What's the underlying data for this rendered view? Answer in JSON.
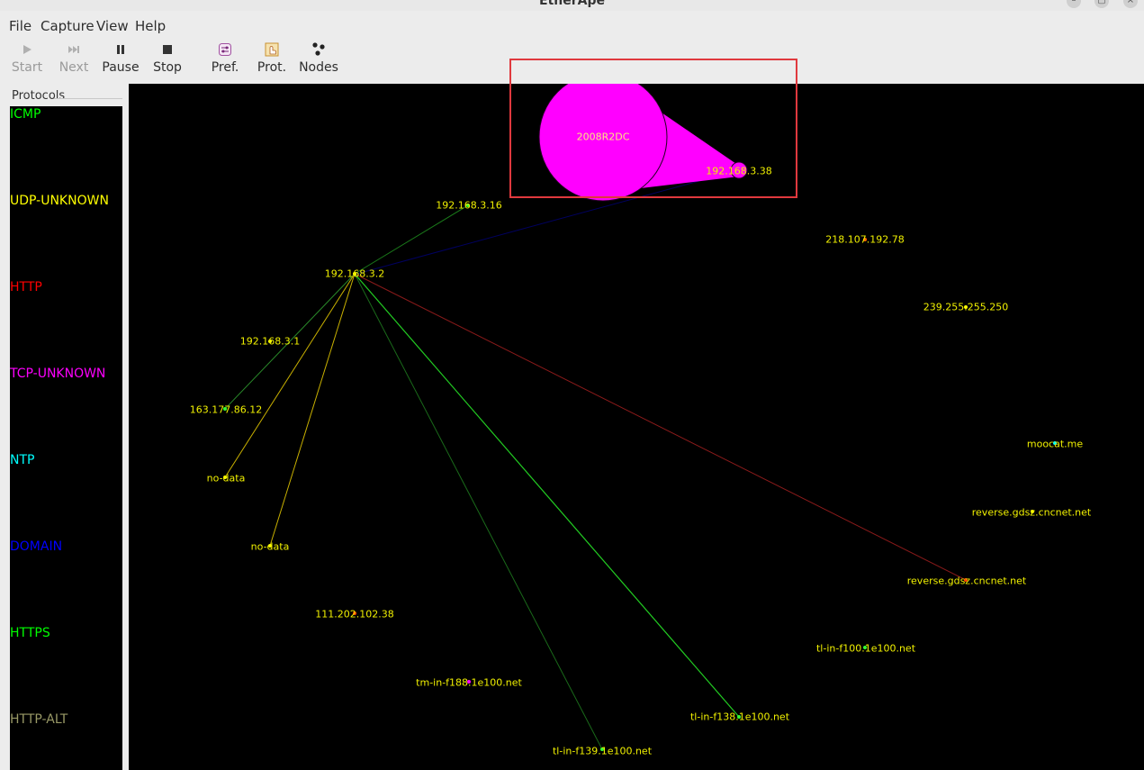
{
  "window": {
    "title": "EtherApe"
  },
  "menu": [
    "File",
    "Capture",
    "View",
    "Help"
  ],
  "toolbar": {
    "start": "Start",
    "next": "Next",
    "pause": "Pause",
    "stop": "Stop",
    "pref": "Pref.",
    "prot": "Prot.",
    "nodes": "Nodes"
  },
  "protocols": {
    "title": "Protocols",
    "items": [
      {
        "name": "ICMP",
        "color": "#00ff00"
      },
      {
        "name": "UDP-UNKNOWN",
        "color": "#ffff00"
      },
      {
        "name": "HTTP",
        "color": "#ff0000"
      },
      {
        "name": "TCP-UNKNOWN",
        "color": "#ff00ff"
      },
      {
        "name": "NTP",
        "color": "#00ffff"
      },
      {
        "name": "DOMAIN",
        "color": "#0000ff"
      },
      {
        "name": "HTTPS",
        "color": "#00ff00"
      },
      {
        "name": "HTTP-ALT",
        "color": "#999966"
      }
    ]
  },
  "nodes": {
    "dc": "2008R2DC",
    "n38": "192.168.3.38",
    "n16": "192.168.3.16",
    "n218": "218.107.192.78",
    "n2": "192.168.3.2",
    "n239": "239.255.255.250",
    "n1": "192.168.3.1",
    "n163": "163.177.86.12",
    "moocat": "moocat.me",
    "nodata1": "no-data",
    "rev1": "reverse.gdsz.cncnet.net",
    "nodata2": "no-data",
    "rev2": "reverse.gdsz.cncnet.net",
    "n111": "111.202.102.38",
    "tl100": "tl-in-f100.1e100.net",
    "tm188": "tm-in-f188.1e100.net",
    "tl138": "tl-in-f138.1e100.net",
    "tl139": "tl-in-f139.1e100.net"
  }
}
